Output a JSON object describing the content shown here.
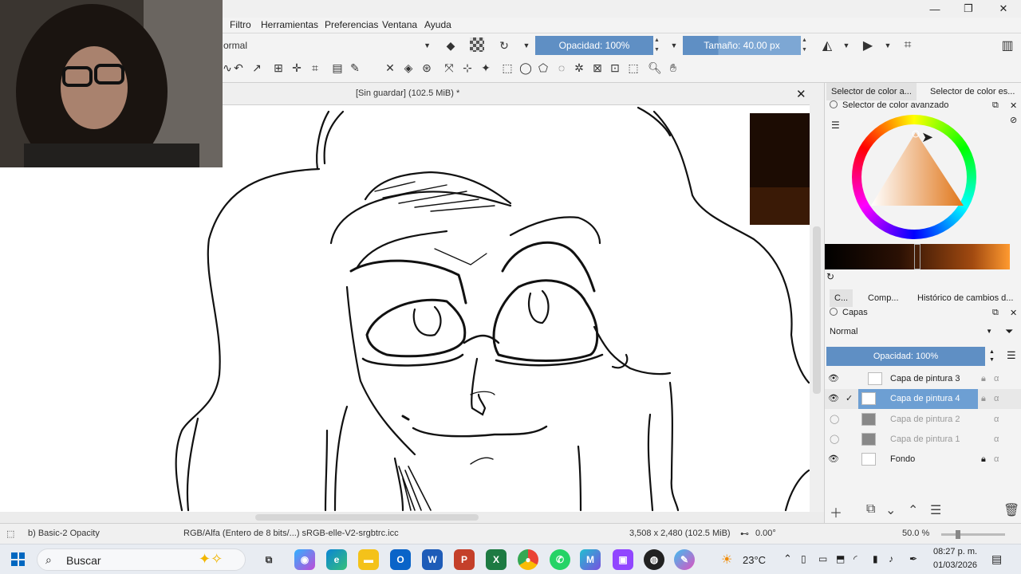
{
  "menu": [
    "Filtro",
    "Herramientas",
    "Preferencias",
    "Ventana",
    "Ayuda"
  ],
  "toolbar": {
    "blend_mode": "ormal",
    "opacity_label": "Opacidad: 100%",
    "size_label": "Tamaño: 40.00 px"
  },
  "document": {
    "title": "[Sin guardar]  (102.5 MiB) *"
  },
  "color_panel": {
    "tabs": [
      "Selector de color a...",
      "Selector de color es..."
    ],
    "title": "Selector de color avanzado",
    "current_color": "#1c0c03",
    "previous_color": "#3a1a06"
  },
  "bottom_tabs": [
    "C...",
    "Comp...",
    "Histórico de cambios d..."
  ],
  "layers_panel": {
    "title": "Capas",
    "blend_mode": "Normal",
    "opacity_label": "Opacidad:  100%",
    "layers": [
      {
        "name": "Capa de pintura 3",
        "visible": true,
        "selected": false
      },
      {
        "name": "Capa de pintura 4",
        "visible": true,
        "selected": true
      },
      {
        "name": "Capa de pintura 2",
        "visible": false,
        "selected": false
      },
      {
        "name": "Capa de pintura 1",
        "visible": false,
        "selected": false
      },
      {
        "name": "Fondo",
        "visible": true,
        "selected": false
      }
    ]
  },
  "status": {
    "brush": "b) Basic-2 Opacity",
    "colorspace": "RGB/Alfa (Entero de 8 bits/...)  sRGB-elle-V2-srgbtrc.icc",
    "dimensions": "3,508 x 2,480 (102.5 MiB)",
    "rotation": "0.00°",
    "zoom": "50.0 %"
  },
  "taskbar": {
    "search_placeholder": "Buscar",
    "weather": "23°C",
    "time": "08:27 p. m.",
    "date": "01/03/2026"
  },
  "colors": {
    "accent": "#5f8fc4",
    "selected_layer": "#6d9fd3"
  }
}
